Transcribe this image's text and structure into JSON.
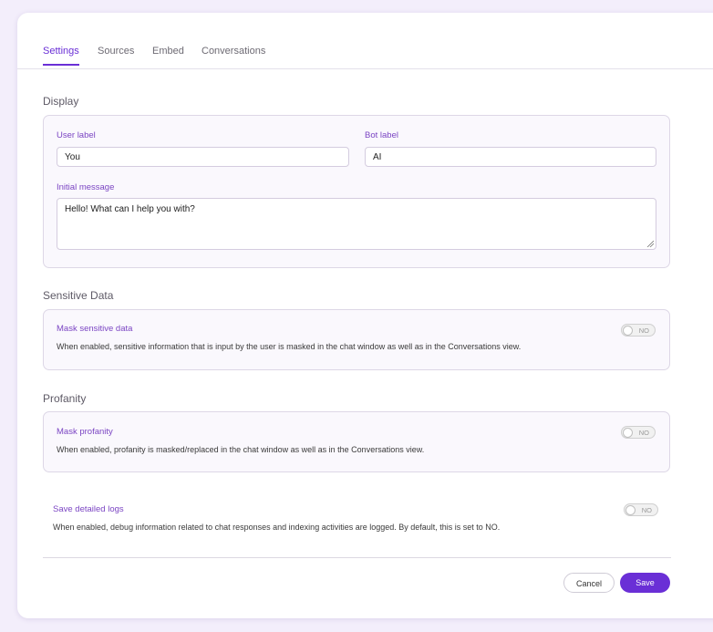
{
  "tabs": [
    {
      "label": "Settings",
      "active": true
    },
    {
      "label": "Sources",
      "active": false
    },
    {
      "label": "Embed",
      "active": false
    },
    {
      "label": "Conversations",
      "active": false
    }
  ],
  "display": {
    "title": "Display",
    "user_label": {
      "label": "User label",
      "value": "You"
    },
    "bot_label": {
      "label": "Bot label",
      "value": "AI"
    },
    "initial_message": {
      "label": "Initial message",
      "value": "Hello! What can I help you with?"
    }
  },
  "sensitive": {
    "title": "Sensitive Data",
    "option_label": "Mask sensitive data",
    "description": "When enabled, sensitive information that is input by the user is masked in the chat window as well as in the Conversations view.",
    "toggle": "NO"
  },
  "profanity": {
    "title": "Profanity",
    "option_label": "Mask profanity",
    "description": "When enabled, profanity is masked/replaced in the chat window as well as in the Conversations view.",
    "toggle": "NO"
  },
  "logs": {
    "option_label": "Save detailed logs",
    "description": "When enabled, debug information related to chat responses and indexing activities are logged. By default, this is set to NO.",
    "toggle": "NO"
  },
  "actions": {
    "cancel": "Cancel",
    "save": "Save"
  },
  "colors": {
    "accent": "#6a2fd6",
    "background": "#f3eefb"
  }
}
